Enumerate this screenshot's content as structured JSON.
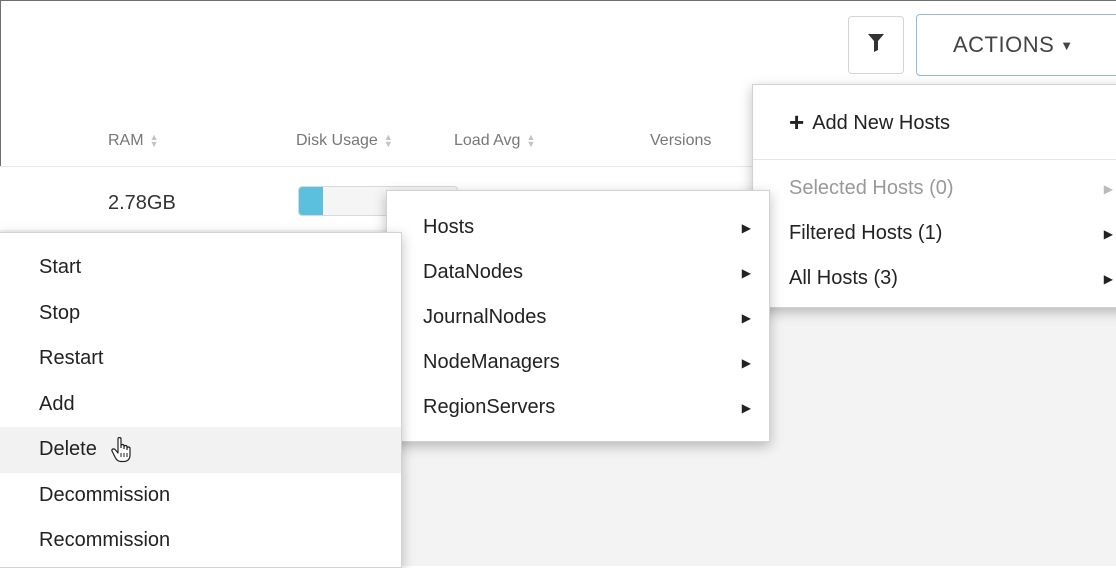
{
  "toolbar": {
    "filter_icon": "filter-icon",
    "actions_label": "ACTIONS"
  },
  "table": {
    "columns": [
      {
        "label": "RAM"
      },
      {
        "label": "Disk Usage"
      },
      {
        "label": "Load Avg"
      },
      {
        "label": "Versions"
      }
    ],
    "row": {
      "ram": "2.78GB",
      "disk_usage_fraction": 0.15
    }
  },
  "actions_menu": {
    "add_new_hosts": "Add New Hosts",
    "groups": [
      {
        "label": "Selected Hosts (0)",
        "disabled": true
      },
      {
        "label": "Filtered Hosts (1)",
        "disabled": false
      },
      {
        "label": "All Hosts (3)",
        "disabled": false
      }
    ]
  },
  "component_menu": {
    "items": [
      "Hosts",
      "DataNodes",
      "JournalNodes",
      "NodeManagers",
      "RegionServers"
    ]
  },
  "operation_menu": {
    "items": [
      "Start",
      "Stop",
      "Restart",
      "Add",
      "Delete",
      "Decommission",
      "Recommission"
    ],
    "hovered": "Delete"
  },
  "colors": {
    "disk_fill": "#5bc0de",
    "actions_border": "#9bb8d3"
  }
}
